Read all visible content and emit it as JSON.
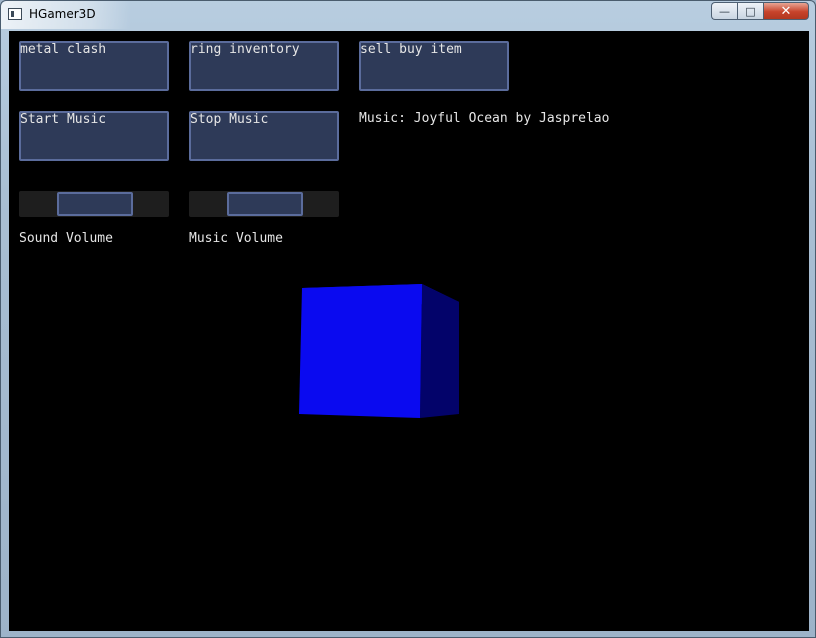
{
  "window": {
    "title": "HGamer3D",
    "controls": {
      "minimize": "—",
      "maximize": "□",
      "close": "✕"
    }
  },
  "buttons": {
    "metal_clash": "metal clash",
    "ring_inventory": "ring inventory",
    "sell_buy_item": "sell buy item",
    "start_music": "Start Music",
    "stop_music": "Stop Music"
  },
  "music_credit": "Music: Joyful Ocean by Jasprelao",
  "sliders": {
    "sound_volume": {
      "label": "Sound Volume",
      "value": 0.51
    },
    "music_volume": {
      "label": "Music Volume",
      "value": 0.51
    }
  },
  "scene": {
    "object": "cube",
    "colors": {
      "front": "#0a0af0",
      "side": "#03036a",
      "top": "#0a10d6"
    }
  }
}
